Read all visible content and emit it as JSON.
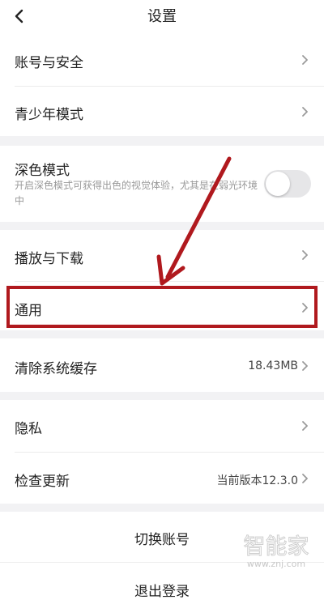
{
  "header": {
    "title": "设置"
  },
  "rows": {
    "account_security": "账号与安全",
    "teen_mode": "青少年模式",
    "dark_mode": "深色模式",
    "dark_mode_desc": "开启深色模式可获得出色的视觉体验，尤其是在弱光环境中",
    "playback_download": "播放与下载",
    "general": "通用",
    "clear_cache": "清除系统缓存",
    "cache_size": "18.43MB",
    "privacy": "隐私",
    "check_update": "检查更新",
    "current_version": "当前版本12.3.0",
    "switch_account": "切换账号",
    "logout": "退出登录"
  },
  "toggles": {
    "dark_mode_on": false
  },
  "watermark": {
    "logo_text": "智能家",
    "site": "www.znj.com"
  },
  "colors": {
    "annotation_red": "#b0191e",
    "background": "#f2f2f4",
    "chevron": "#9a9a9a"
  },
  "icons": {
    "back": "chevron-left-icon",
    "row_arrow": "chevron-right-icon"
  }
}
